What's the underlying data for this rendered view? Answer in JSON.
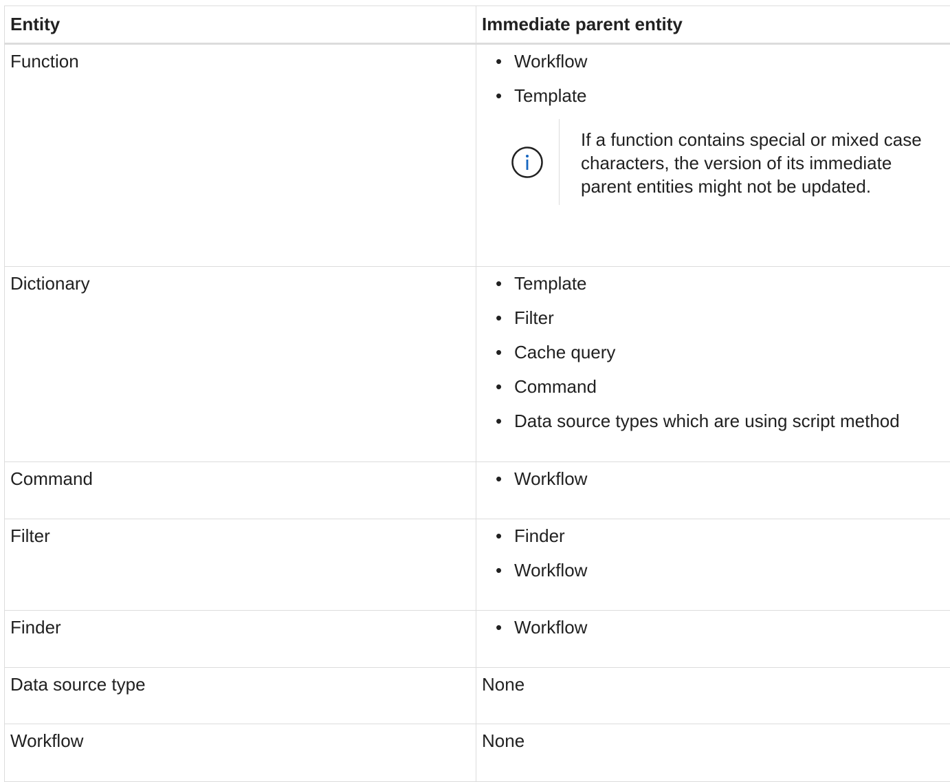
{
  "table": {
    "headers": {
      "entity": "Entity",
      "parent": "Immediate parent entity"
    },
    "rows": [
      {
        "entity": "Function",
        "parents": [
          "Workflow",
          "Template"
        ],
        "note": "If a function contains special or mixed case characters, the version of its immediate parent entities might not be updated."
      },
      {
        "entity": "Dictionary",
        "parents": [
          "Template",
          "Filter",
          "Cache query",
          "Command",
          "Data source types which are using script method"
        ]
      },
      {
        "entity": "Command",
        "parents": [
          "Workflow"
        ]
      },
      {
        "entity": "Filter",
        "parents": [
          "Finder",
          "Workflow"
        ]
      },
      {
        "entity": "Finder",
        "parents": [
          "Workflow"
        ]
      },
      {
        "entity": "Data source type",
        "parents_text": "None"
      },
      {
        "entity": "Workflow",
        "parents_text": "None"
      }
    ]
  },
  "bullet_glyph": "•",
  "icons": {
    "note": "info-circle-icon"
  },
  "colors": {
    "border": "#dcdcdc",
    "text": "#212121",
    "info_icon": "#1565c0"
  }
}
